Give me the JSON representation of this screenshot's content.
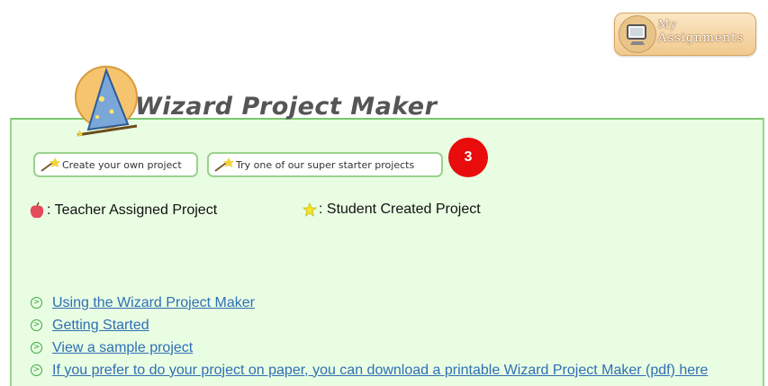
{
  "header": {
    "my_assignments": {
      "line1": "My",
      "line2": "Assignments"
    },
    "title": "Wizard Project Maker"
  },
  "actions": {
    "create_label": "Create your own project",
    "starter_label": "Try one of our super starter projects",
    "step_badge": "3"
  },
  "legend": {
    "teacher": ": Teacher Assigned Project",
    "student": ": Student Created Project"
  },
  "links": [
    "Using the Wizard Project Maker",
    "Getting Started",
    "View a sample project",
    "If you prefer to do your project on paper, you can download a printable Wizard Project Maker (pdf) here"
  ],
  "colors": {
    "panel_bg": "#e9fde3",
    "panel_border": "#7cc76f",
    "badge": "#e80c0c",
    "link": "#2e6fb4"
  },
  "icons": [
    "monitor-icon",
    "wizard-hat-icon",
    "magic-wand-icon",
    "apple-icon",
    "star-icon",
    "arrow-circle-icon"
  ]
}
